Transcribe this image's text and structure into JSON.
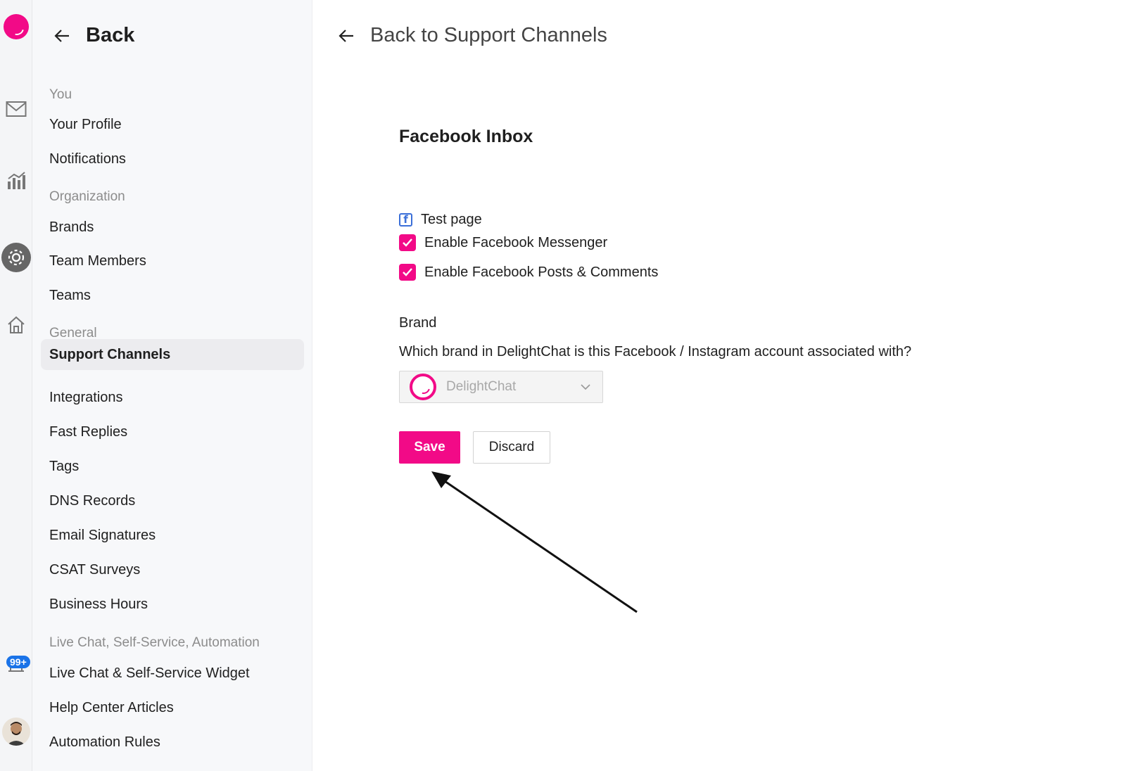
{
  "rail": {
    "icons": [
      "delightchat-logo-icon",
      "mail-icon",
      "analytics-icon",
      "settings-gear-icon",
      "home-icon",
      "notification-icon",
      "user-avatar"
    ],
    "badge": "99+"
  },
  "sidebar": {
    "back_label": "Back",
    "sections": {
      "you": "You",
      "organization": "Organization",
      "general": "General",
      "live_chat": "Live Chat, Self-Service, Automation"
    },
    "items": {
      "your_profile": "Your Profile",
      "notifications": "Notifications",
      "brands": "Brands",
      "team_members": "Team Members",
      "teams": "Teams",
      "support_channels": "Support Channels",
      "integrations": "Integrations",
      "fast_replies": "Fast Replies",
      "tags": "Tags",
      "dns_records": "DNS Records",
      "email_signatures": "Email Signatures",
      "csat_surveys": "CSAT Surveys",
      "business_hours": "Business Hours",
      "live_chat_widget": "Live Chat & Self-Service Widget",
      "help_center_articles": "Help Center Articles",
      "automation_rules": "Automation Rules"
    },
    "active_item": "Support Channels"
  },
  "main": {
    "back_label": "Back to Support Channels",
    "title": "Facebook Inbox",
    "page_name": "Test page",
    "options": {
      "messenger": {
        "label": "Enable Facebook Messenger",
        "checked": true
      },
      "posts": {
        "label": "Enable Facebook Posts & Comments",
        "checked": true
      }
    },
    "brand_label": "Brand",
    "brand_question": "Which brand in DelightChat is this Facebook / Instagram account associated with?",
    "brand_select_value": "DelightChat",
    "save_label": "Save",
    "discard_label": "Discard"
  },
  "colors": {
    "accent": "#f20a87",
    "facebook_blue": "#3b6fd8",
    "badge_blue": "#1a73e8"
  }
}
